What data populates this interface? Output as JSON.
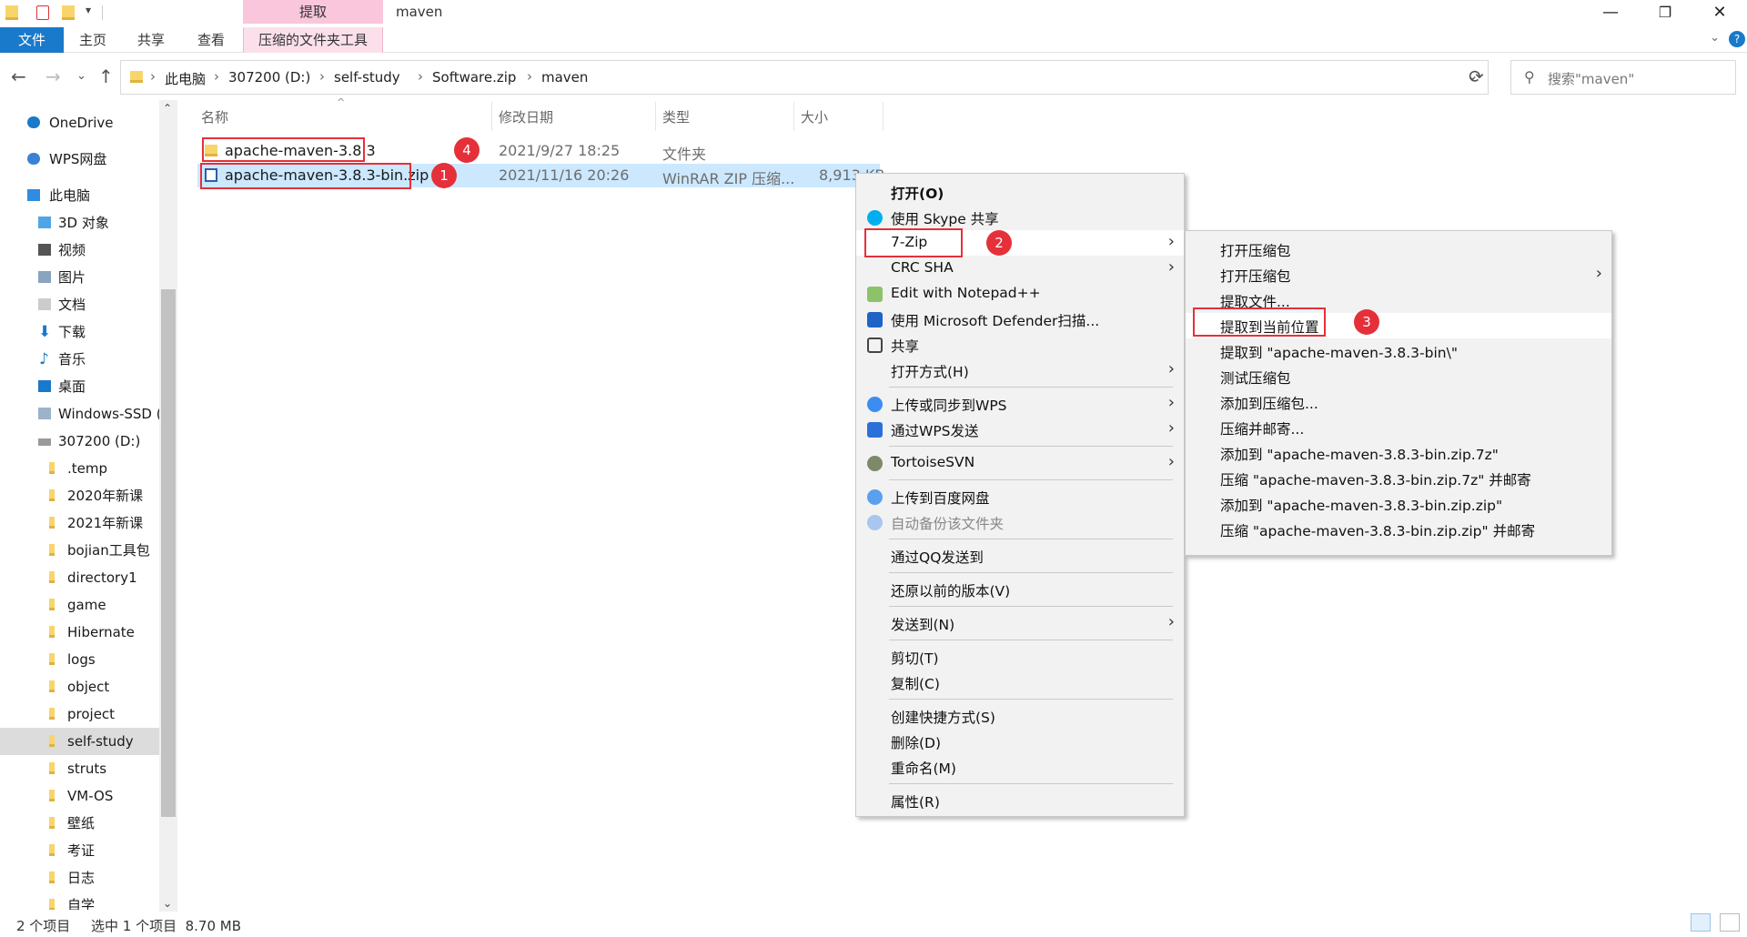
{
  "window": {
    "title": "maven",
    "contextual_group": "提取",
    "minimize": "—",
    "maximize": "❐",
    "close": "✕"
  },
  "ribbon": {
    "tabs": [
      "文件",
      "主页",
      "共享",
      "查看",
      "压缩的文件夹工具"
    ],
    "help": "?"
  },
  "address": {
    "crumbs": [
      "此电脑",
      "307200 (D:)",
      "self-study",
      "Software.zip",
      "maven"
    ],
    "search_placeholder": "搜索\"maven\""
  },
  "sidebar": {
    "items": [
      {
        "label": "OneDrive",
        "icon": "cloud-icon"
      },
      {
        "label": "WPS网盘",
        "icon": "cloud-icon"
      },
      {
        "label": "此电脑",
        "icon": "computer-icon"
      },
      {
        "label": "3D 对象",
        "icon": "cube-icon"
      },
      {
        "label": "视频",
        "icon": "film-icon"
      },
      {
        "label": "图片",
        "icon": "picture-icon"
      },
      {
        "label": "文档",
        "icon": "document-icon"
      },
      {
        "label": "下载",
        "icon": "download-icon"
      },
      {
        "label": "音乐",
        "icon": "music-icon"
      },
      {
        "label": "桌面",
        "icon": "desktop-icon"
      },
      {
        "label": "Windows-SSD (",
        "icon": "drive-icon"
      },
      {
        "label": "307200 (D:)",
        "icon": "drive-icon"
      },
      {
        "label": ".temp",
        "icon": "folder-icon"
      },
      {
        "label": "2020年新课",
        "icon": "folder-icon"
      },
      {
        "label": "2021年新课",
        "icon": "folder-icon"
      },
      {
        "label": "bojian工具包",
        "icon": "folder-icon"
      },
      {
        "label": "directory1",
        "icon": "folder-icon"
      },
      {
        "label": "game",
        "icon": "folder-icon"
      },
      {
        "label": "Hibernate",
        "icon": "folder-icon"
      },
      {
        "label": "logs",
        "icon": "folder-icon"
      },
      {
        "label": "object",
        "icon": "folder-icon"
      },
      {
        "label": "project",
        "icon": "folder-icon"
      },
      {
        "label": "self-study",
        "icon": "folder-icon"
      },
      {
        "label": "struts",
        "icon": "folder-icon"
      },
      {
        "label": "VM-OS",
        "icon": "folder-icon"
      },
      {
        "label": "壁纸",
        "icon": "folder-icon"
      },
      {
        "label": "考证",
        "icon": "folder-icon"
      },
      {
        "label": "日志",
        "icon": "folder-icon"
      },
      {
        "label": "自学",
        "icon": "folder-icon"
      }
    ],
    "selected": "self-study"
  },
  "columns": {
    "name": "名称",
    "date": "修改日期",
    "type": "类型",
    "size": "大小"
  },
  "files": [
    {
      "name": "apache-maven-3.8.3",
      "date": "2021/9/27 18:25",
      "type": "文件夹",
      "size": ""
    },
    {
      "name": "apache-maven-3.8.3-bin.zip",
      "date": "2021/11/16 20:26",
      "type": "WinRAR ZIP 压缩...",
      "size": "8,913 KB"
    }
  ],
  "annotations": [
    "1",
    "2",
    "3",
    "4"
  ],
  "context_menu": {
    "items": [
      "打开(O)",
      "使用 Skype 共享",
      "7-Zip",
      "CRC SHA",
      "Edit with Notepad++",
      "使用 Microsoft Defender扫描...",
      "共享",
      "打开方式(H)",
      "上传或同步到WPS",
      "通过WPS发送",
      "TortoiseSVN",
      "上传到百度网盘",
      "自动备份该文件夹",
      "通过QQ发送到",
      "还原以前的版本(V)",
      "发送到(N)",
      "剪切(T)",
      "复制(C)",
      "创建快捷方式(S)",
      "删除(D)",
      "重命名(M)",
      "属性(R)"
    ]
  },
  "submenu_7zip": {
    "items": [
      "打开压缩包",
      "打开压缩包",
      "提取文件...",
      "提取到当前位置",
      "提取到 \"apache-maven-3.8.3-bin\\\"",
      "测试压缩包",
      "添加到压缩包...",
      "压缩并邮寄...",
      "添加到 \"apache-maven-3.8.3-bin.zip.7z\"",
      "压缩 \"apache-maven-3.8.3-bin.zip.7z\" 并邮寄",
      "添加到 \"apache-maven-3.8.3-bin.zip.zip\"",
      "压缩 \"apache-maven-3.8.3-bin.zip.zip\" 并邮寄"
    ]
  },
  "status": {
    "count": "2 个项目",
    "selection": "选中 1 个项目  8.70 MB"
  }
}
